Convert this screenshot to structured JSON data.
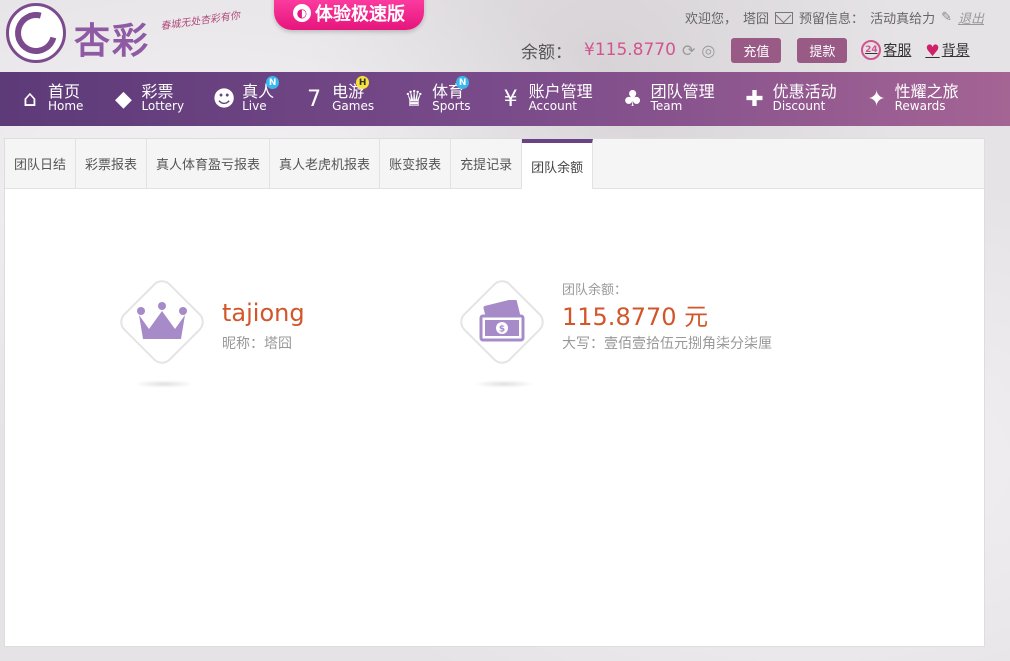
{
  "header": {
    "logo_text": "杏彩",
    "slogan": "春城无处杏彩有你",
    "promo_label": "体验极速版",
    "welcome": "欢迎您，",
    "username_top": "塔囧",
    "reserved_info": "预留信息：",
    "reserved_value": "活动真给力",
    "logout": "退出",
    "balance_label": "余额：",
    "balance_value": "¥115.8770",
    "recharge": "充值",
    "withdraw": "提款",
    "service": "客服",
    "background": "背景",
    "badge_24": "24"
  },
  "nav": [
    {
      "cn": "首页",
      "en": "Home",
      "icon": "home-icon",
      "glyph": "⌂",
      "badge": ""
    },
    {
      "cn": "彩票",
      "en": "Lottery",
      "icon": "ticket-icon",
      "glyph": "◆",
      "badge": ""
    },
    {
      "cn": "真人",
      "en": "Live",
      "icon": "dealer-icon",
      "glyph": "☻",
      "badge": "N"
    },
    {
      "cn": "电游",
      "en": "Games",
      "icon": "slot-seven-icon",
      "glyph": "7",
      "badge": "H"
    },
    {
      "cn": "体育",
      "en": "Sports",
      "icon": "trophy-icon",
      "glyph": "♛",
      "badge": "N"
    },
    {
      "cn": "账户管理",
      "en": "Account",
      "icon": "yen-coin-icon",
      "glyph": "¥",
      "badge": ""
    },
    {
      "cn": "团队管理",
      "en": "Team",
      "icon": "team-icon",
      "glyph": "♣",
      "badge": ""
    },
    {
      "cn": "优惠活动",
      "en": "Discount",
      "icon": "gift-icon",
      "glyph": "✚",
      "badge": ""
    },
    {
      "cn": "性耀之旅",
      "en": "Rewards",
      "icon": "rewards-icon",
      "glyph": "✦",
      "badge": ""
    }
  ],
  "tabs": [
    {
      "label": "团队日结",
      "active": false
    },
    {
      "label": "彩票报表",
      "active": false
    },
    {
      "label": "真人体育盈亏报表",
      "active": false
    },
    {
      "label": "真人老虎机报表",
      "active": false
    },
    {
      "label": "账变报表",
      "active": false
    },
    {
      "label": "充提记录",
      "active": false
    },
    {
      "label": "团队余额",
      "active": true
    }
  ],
  "user_card": {
    "username": "tajiong",
    "nickname": "昵称：塔囧"
  },
  "team_card": {
    "label": "团队余额：",
    "amount": "115.8770 元",
    "upper": "大写：壹佰壹拾伍元捌角柒分柒厘"
  },
  "colors": {
    "accent": "#6b4385",
    "amount": "#d2562a",
    "pink": "#d05590"
  }
}
